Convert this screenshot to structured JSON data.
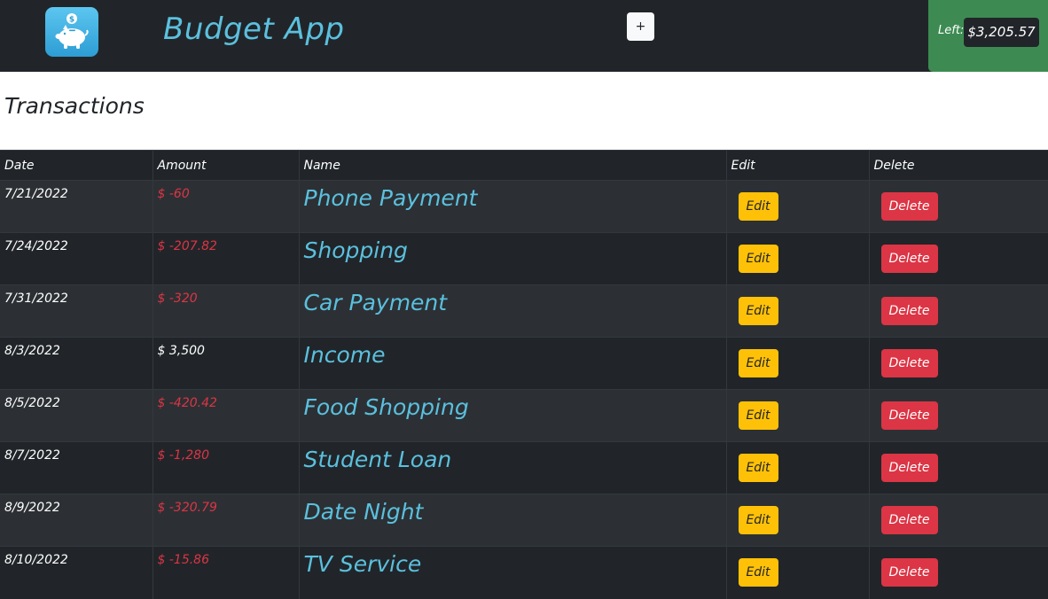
{
  "header": {
    "title": "Budget App",
    "logo_icon": "piggy-bank-icon",
    "add_button_label": "+",
    "balance_label": "Left:",
    "balance_value": "$3,205.57"
  },
  "section": {
    "title": "Transactions"
  },
  "table": {
    "columns": [
      "Date",
      "Amount",
      "Name",
      "Edit",
      "Delete"
    ],
    "rows": [
      {
        "date": "7/21/2022",
        "amount": "$ -60",
        "name": "Phone Payment",
        "edit": "Edit",
        "delete": "Delete"
      },
      {
        "date": "7/24/2022",
        "amount": "$ -207.82",
        "name": "Shopping",
        "edit": "Edit",
        "delete": "Delete"
      },
      {
        "date": "7/31/2022",
        "amount": "$ -320",
        "name": "Car Payment",
        "edit": "Edit",
        "delete": "Delete"
      },
      {
        "date": "8/3/2022",
        "amount": "$ 3,500",
        "name": "Income",
        "edit": "Edit",
        "delete": "Delete"
      },
      {
        "date": "8/5/2022",
        "amount": "$ -420.42",
        "name": "Food Shopping",
        "edit": "Edit",
        "delete": "Delete"
      },
      {
        "date": "8/7/2022",
        "amount": "$ -1,280",
        "name": "Student Loan",
        "edit": "Edit",
        "delete": "Delete"
      },
      {
        "date": "8/9/2022",
        "amount": "$ -320.79",
        "name": "Date Night",
        "edit": "Edit",
        "delete": "Delete"
      },
      {
        "date": "8/10/2022",
        "amount": "$ -15.86",
        "name": "TV Service",
        "edit": "Edit",
        "delete": "Delete"
      }
    ]
  },
  "colors": {
    "header_bg": "#212529",
    "title_accent": "#5bc0de",
    "balance_panel": "#3d8b52",
    "negative_amount": "#dc3545",
    "positive_amount": "#ffffff",
    "edit_button": "#ffc107",
    "delete_button": "#dc3545"
  }
}
